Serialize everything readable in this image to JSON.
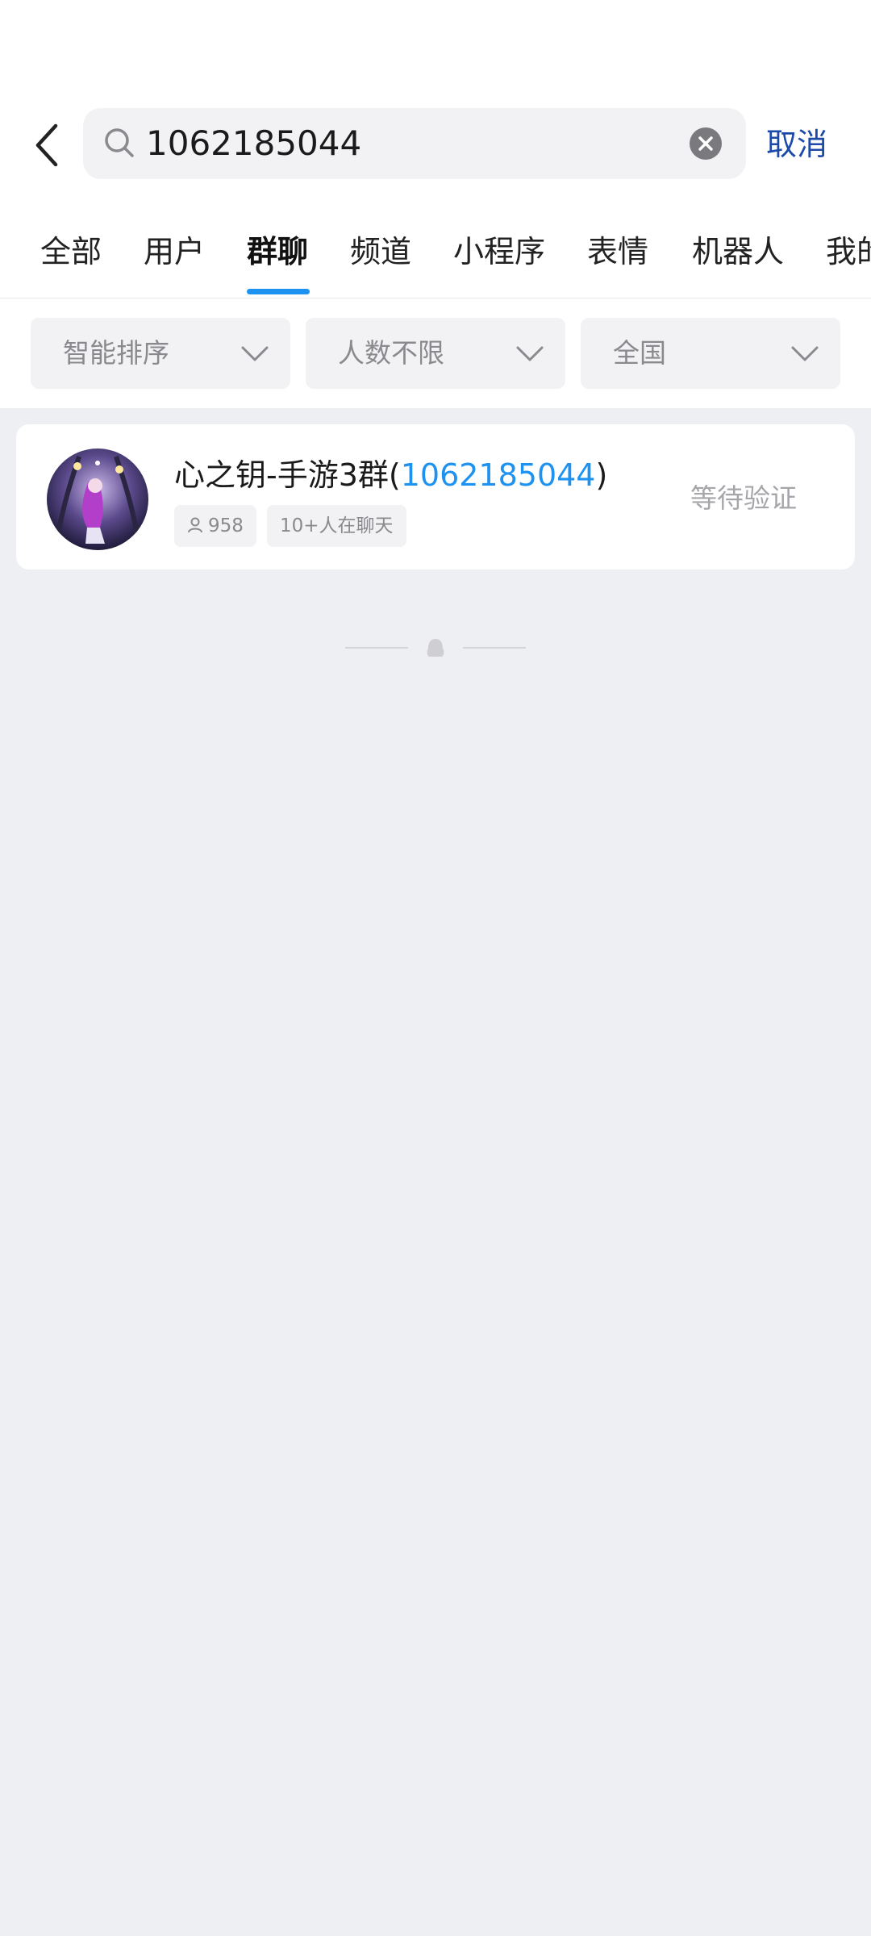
{
  "search": {
    "query": "1062185044",
    "cancel_label": "取消"
  },
  "tabs": [
    {
      "label": "全部"
    },
    {
      "label": "用户"
    },
    {
      "label": "群聊"
    },
    {
      "label": "频道"
    },
    {
      "label": "小程序"
    },
    {
      "label": "表情"
    },
    {
      "label": "机器人"
    },
    {
      "label": "我的"
    }
  ],
  "active_tab": "群聊",
  "filters": {
    "sort": "智能排序",
    "members": "人数不限",
    "region": "全国"
  },
  "results": [
    {
      "name_prefix": "心之钥-手游3群(",
      "name_number": "1062185044",
      "name_suffix": ")",
      "member_count": "958",
      "active_chat": "10+人在聊天",
      "status": "等待验证"
    }
  ],
  "colors": {
    "accent": "#1e92f0",
    "cancel": "#1d4aa8",
    "background": "#eeeff2"
  }
}
